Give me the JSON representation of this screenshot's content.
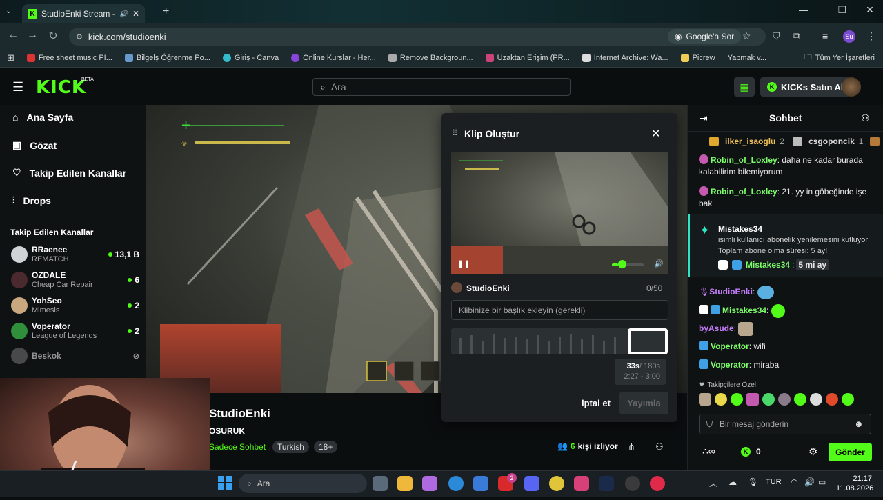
{
  "browser": {
    "tab_title": "StudioEnki Stream - Watch",
    "url": "kick.com/studioenki",
    "google_sor": "Google'a Sor",
    "profile": "Su",
    "bookmarks": [
      "Free sheet music PI...",
      "Bilgelş Öğrenme Po...",
      "Giriş - Canva",
      "Online Kurslar - Her...",
      "Remove Backgroun...",
      "Uzaktan Erişim (PR...",
      "Internet Archive: Wa...",
      "Picrew",
      "Yapmak v..."
    ],
    "all_bookmarks": "Tüm Yer İşaretleri"
  },
  "kick": {
    "logo": "KICK",
    "beta": "BETA",
    "search_placeholder": "Ara",
    "kicks_button": "KICKs Satın Al"
  },
  "sidebar": {
    "nav": [
      "Ana Sayfa",
      "Gözat",
      "Takip Edilen Kanallar",
      "Drops"
    ],
    "followed_header": "Takip Edilen Kanallar",
    "channels": [
      {
        "name": "RRaenee",
        "game": "REMATCH",
        "viewers": "13,1 B",
        "color": "#cfd3d6"
      },
      {
        "name": "OZDALE",
        "game": "Cheap Car Repair",
        "viewers": "6",
        "color": "#4a2a2e"
      },
      {
        "name": "YohSeo",
        "game": "Mimesis",
        "viewers": "2",
        "color": "#c9a77f"
      },
      {
        "name": "Voperator",
        "game": "League of Legends",
        "viewers": "2",
        "color": "#2f8f3a"
      },
      {
        "name": "Beskok",
        "game": "",
        "viewers": "",
        "color": "#777"
      }
    ]
  },
  "channel": {
    "name": "StudioEnki",
    "stream_title": "OSURUK",
    "chat_mode": "Sadece Sohbet",
    "tags": [
      "Turkish",
      "18+"
    ],
    "viewers_count": "6",
    "viewers_label": "kişi izliyor"
  },
  "clip": {
    "title": "Klip Oluştur",
    "author": "StudioEnki",
    "char_count": "0/50",
    "placeholder": "Klibinize bir başlık ekleyin (gerekli)",
    "duration": "33s",
    "duration_max": "/ 180s",
    "range": "2:27 - 3:00",
    "cancel": "İptal et",
    "publish": "Yayımla",
    "volume_level": 0.2
  },
  "chat": {
    "title": "Sohbet",
    "top_gifters": [
      {
        "name": "ilker_isaoglu",
        "count": "2"
      },
      {
        "name": "csgoponcik",
        "count": "1"
      }
    ],
    "messages": [
      {
        "user": "Robin_of_Loxley",
        "text": "daha ne kadar burada kalabilirim bilemiyorum",
        "color": "#7dfc6a"
      },
      {
        "user": "Robin_of_Loxley",
        "text": "21. yy in göbeğinde işe bak",
        "color": "#7dfc6a"
      }
    ],
    "sub_event": {
      "user": "Mistakes34",
      "text": "isimli kullanıcı abonelik yenilemesini kutluyor! Toplam abone olma süresi: 5 ay!",
      "reply_user": "Mistakes34",
      "reply_text": "5 mi ay"
    },
    "messages2": [
      {
        "user": "StudioEnki",
        "text": "",
        "color": "#c67dfc"
      },
      {
        "user": "Mistakes34",
        "text": "",
        "color": "#7dfc6a"
      },
      {
        "user": "byAsude",
        "text": "",
        "color": "#c67dfc"
      },
      {
        "user": "Voperator",
        "text": "wifi",
        "color": "#7dfc6a"
      },
      {
        "user": "Voperator",
        "text": "miraba",
        "color": "#7dfc6a"
      }
    ],
    "followers_only": "Takipçilere Özel",
    "input_placeholder": "Bir mesaj gönderin",
    "kicks_count": "0",
    "send": "Gönder"
  },
  "taskbar": {
    "search": "Ara",
    "lang": "TUR",
    "time": "21:17",
    "date": "11.08.2026",
    "badge_count": "2"
  }
}
